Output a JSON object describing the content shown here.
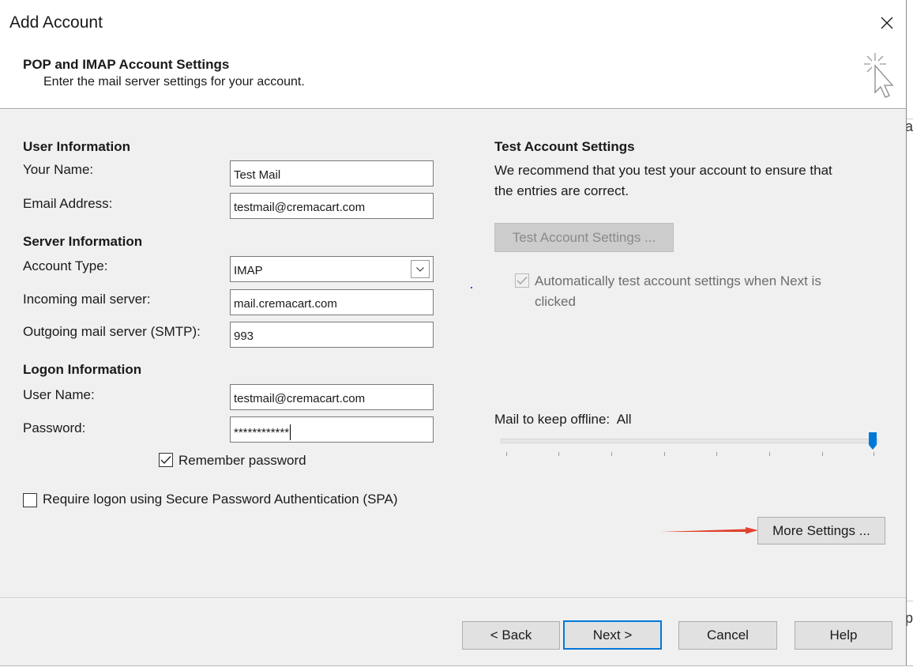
{
  "dialog": {
    "title": "Add Account",
    "close_icon": "close-icon",
    "header_title": "POP and IMAP Account Settings",
    "header_subtitle": "Enter the mail server settings for your account.",
    "header_icon": "cursor-sparkle-icon"
  },
  "user_info": {
    "heading": "User Information",
    "name_label": "Your Name:",
    "name_value": "Test Mail",
    "email_label": "Email Address:",
    "email_value": "testmail@cremacart.com"
  },
  "server_info": {
    "heading": "Server Information",
    "account_type_label": "Account Type:",
    "account_type_value": "IMAP",
    "incoming_label": "Incoming mail server:",
    "incoming_value": "mail.cremacart.com",
    "outgoing_label": "Outgoing mail server (SMTP):",
    "outgoing_value": "993"
  },
  "logon_info": {
    "heading": "Logon Information",
    "username_label": "User Name:",
    "username_value": "testmail@cremacart.com",
    "password_label": "Password:",
    "password_value": "************",
    "remember_label": "Remember password",
    "remember_checked": true,
    "spa_label": "Require logon using Secure Password Authentication (SPA)",
    "spa_checked": false
  },
  "test_settings": {
    "heading": "Test Account Settings",
    "description_line1": "We recommend that you test your account to ensure that",
    "description_line2": "the entries are correct.",
    "button_label": "Test Account Settings ...",
    "auto_test_line1": "Automatically test account settings when Next is",
    "auto_test_line2": "clicked",
    "auto_test_checked": true
  },
  "offline": {
    "label": "Mail to keep offline:",
    "value": "All",
    "slider_position": 1.0
  },
  "more_settings_label": "More Settings ...",
  "footer": {
    "back_label": "< Back",
    "next_label": "Next >",
    "cancel_label": "Cancel",
    "help_label": "Help"
  },
  "colors": {
    "accent": "#0078d7",
    "annotation_arrow": "#e0432f",
    "panel_bg": "#f0f0f0"
  }
}
